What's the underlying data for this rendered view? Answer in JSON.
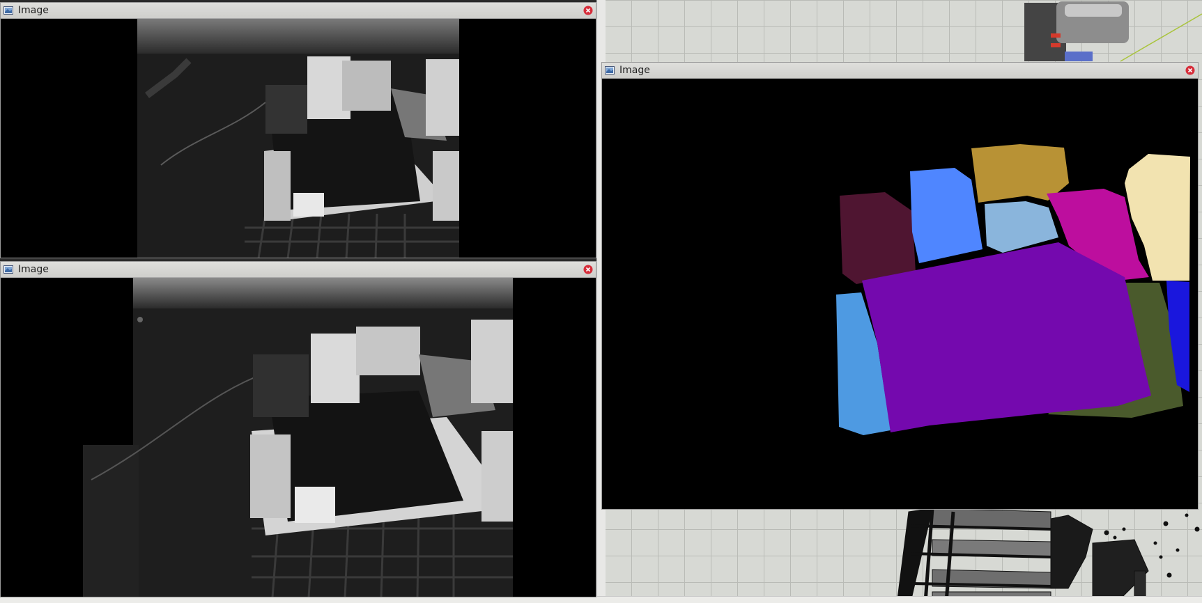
{
  "windows": {
    "top_left": {
      "title": "Image"
    },
    "bottom_left": {
      "title": "Image"
    },
    "right": {
      "title": "Image"
    }
  },
  "icons": {
    "window_app_icon": "image-icon",
    "window_close": "close-icon"
  },
  "colors": {
    "titlebar": "#d8d8d5",
    "close_red": "#d62d3a",
    "segment_maroon": "#4f1531",
    "segment_blue": "#4f86ff",
    "segment_gold": "#b89235",
    "segment_light_blue": "#8ab5dc",
    "segment_magenta": "#bd0e9e",
    "segment_cream": "#f2e3b0",
    "segment_purple": "#7409ae",
    "segment_sky": "#4e9ae2",
    "segment_olive": "#4a5a2c",
    "segment_deep_blue": "#1a17dd"
  }
}
